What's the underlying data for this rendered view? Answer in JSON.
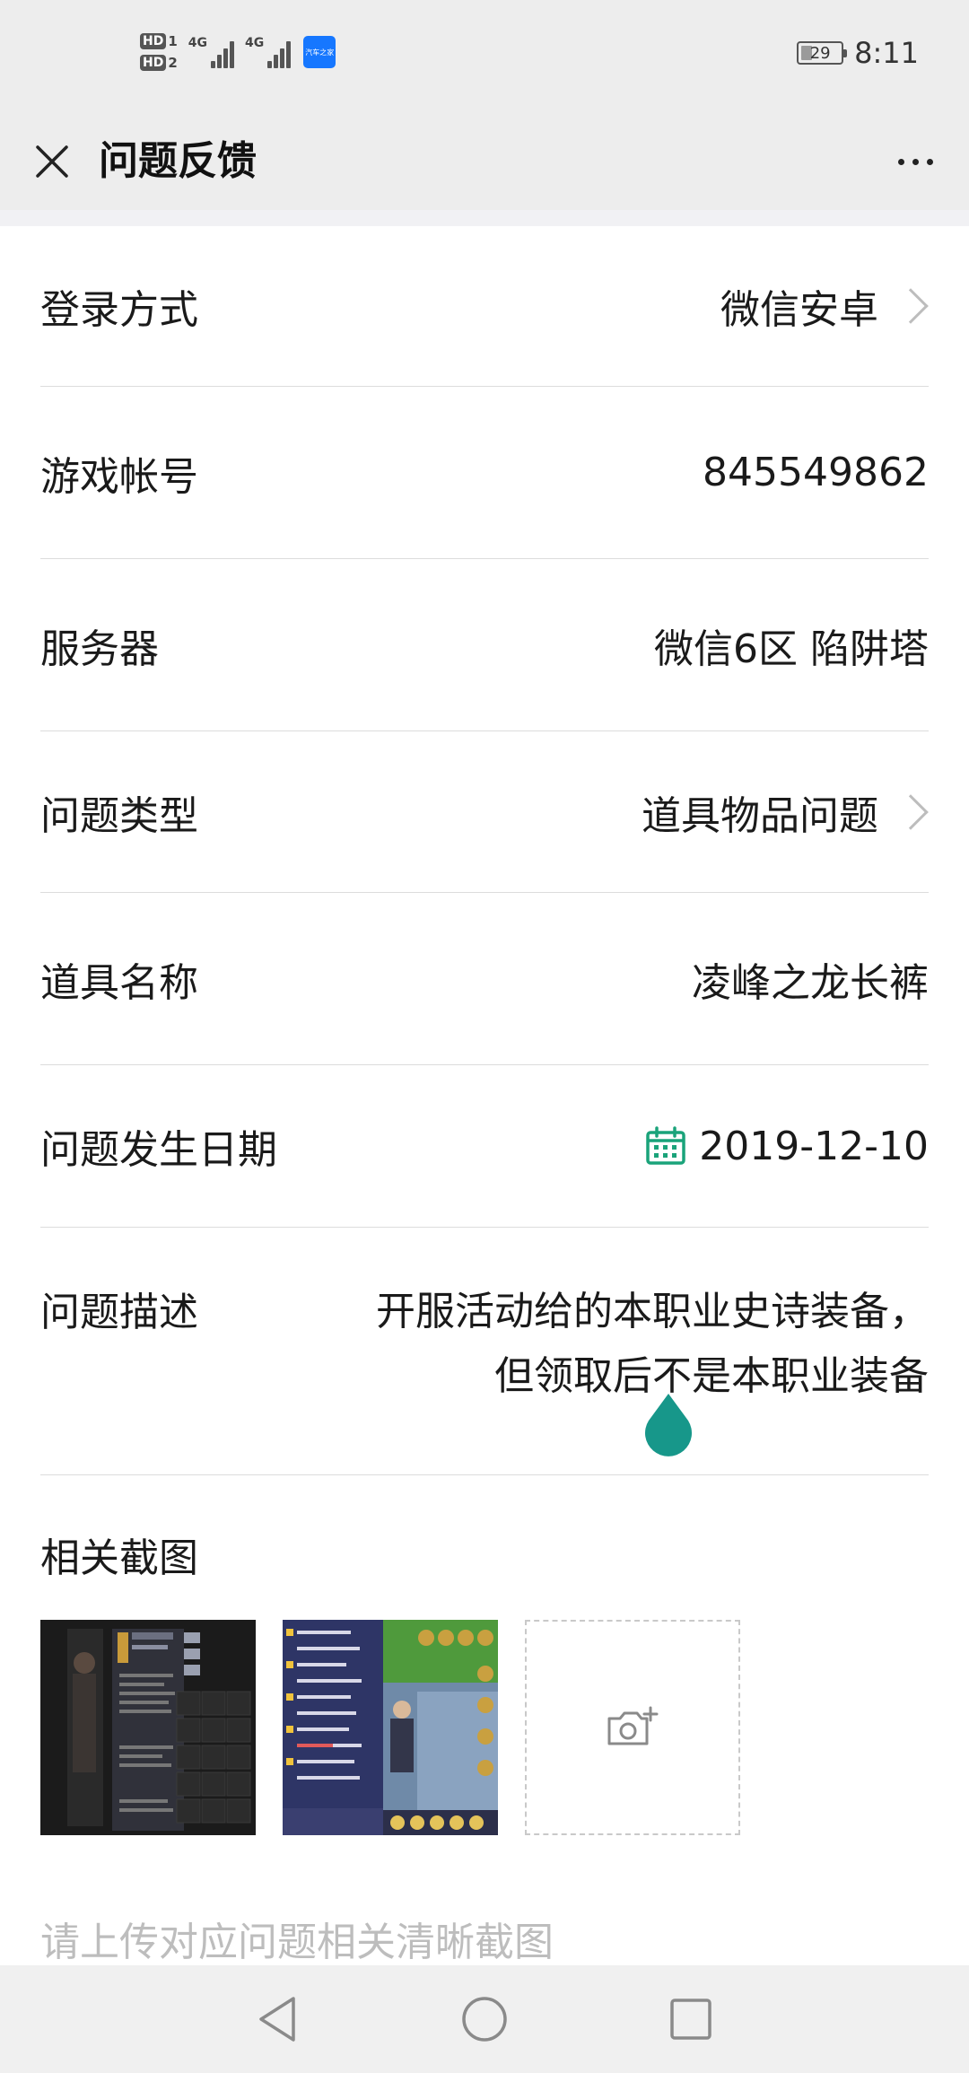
{
  "status_bar": {
    "sim1_label": "HD",
    "sim1_index": "1",
    "sim2_label": "HD",
    "sim2_index": "2",
    "net1": "4G",
    "net2": "4G",
    "app_badge": "汽车之家",
    "battery_level": "29",
    "battery_fraction": 0.29,
    "time": "8:11"
  },
  "header": {
    "title": "问题反馈",
    "close_icon": "close-icon",
    "more_icon": "more-icon"
  },
  "form": {
    "login_method": {
      "label": "登录方式",
      "value": "微信安卓"
    },
    "game_account": {
      "label": "游戏帐号",
      "value": "845549862"
    },
    "server": {
      "label": "服务器",
      "value": "微信6区 陷阱塔"
    },
    "issue_type": {
      "label": "问题类型",
      "value": "道具物品问题"
    },
    "item_name": {
      "label": "道具名称",
      "value": "凌峰之龙长裤"
    },
    "issue_date": {
      "label": "问题发生日期",
      "value": "2019-12-10",
      "icon": "calendar-icon"
    },
    "description": {
      "label": "问题描述",
      "value": "开服活动给的本职业史诗装备，但领取后不是本职业装备"
    }
  },
  "screenshots": {
    "title": "相关截图",
    "add_icon": "camera-add-icon",
    "hint": "请上传对应问题相关清晰截图"
  },
  "colors": {
    "accent": "#1aa37a",
    "teal_handle": "#17978a",
    "divider": "#dcdcdc",
    "placeholder": "#bdbdbd",
    "bar_bg": "#ededed"
  }
}
